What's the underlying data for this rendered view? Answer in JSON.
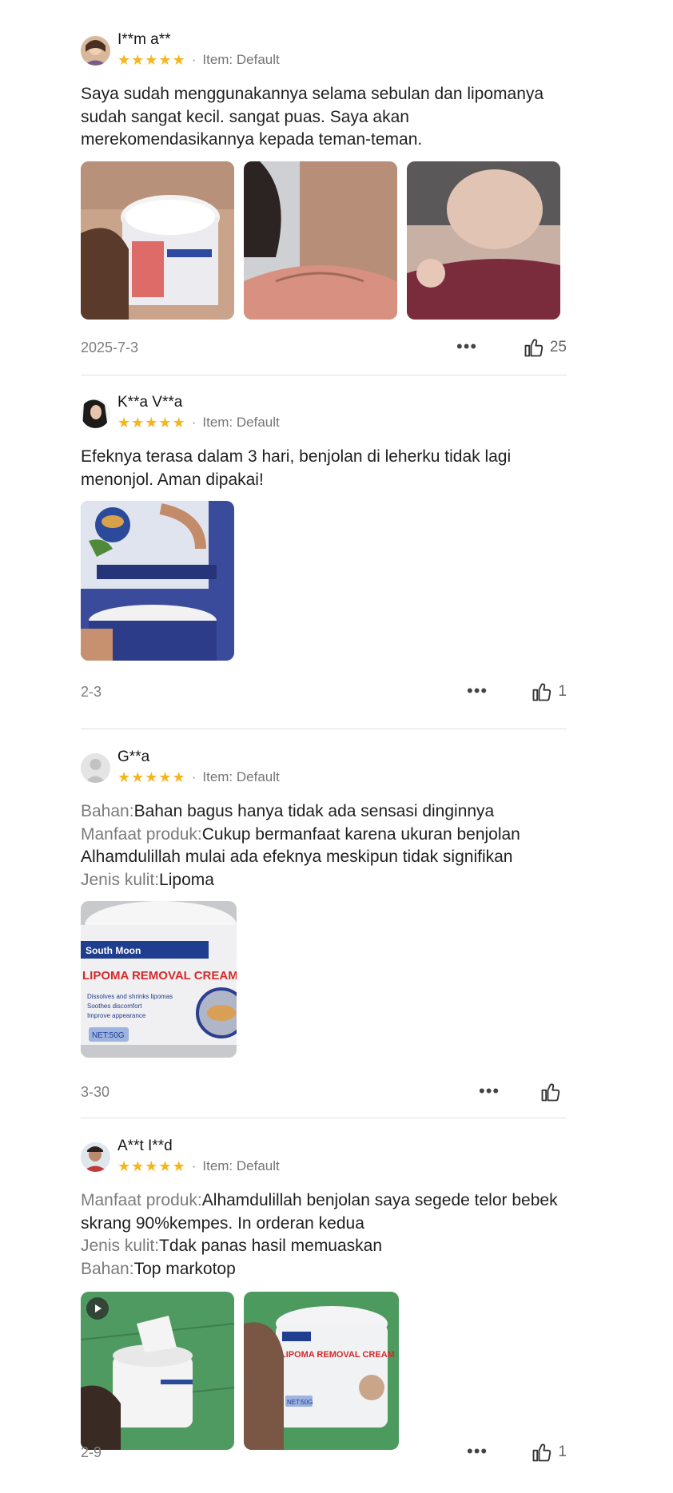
{
  "colors": {
    "star": "#f7b51c",
    "label": "#7b7b7b",
    "divider": "#e2e2e2"
  },
  "reviews": [
    {
      "username": "I**m a**",
      "stars": 5,
      "item": "Item: Default",
      "text": "Saya sudah menggunakannya selama sebulan dan lipomanya sudah sangat kecil. sangat puas. Saya akan merekomendasikannya kepada teman-teman.",
      "photo_count": 3,
      "date": "2025-7-3",
      "likes": "25"
    },
    {
      "username": "K**a V**a",
      "stars": 5,
      "item": "Item: Default",
      "text": "Efeknya terasa dalam 3 hari, benjolan di leherku tidak lagi menonjol. Aman dipakai!",
      "photo_count": 1,
      "date": "2-3",
      "likes": "1"
    },
    {
      "username": "G**a",
      "stars": 5,
      "item": "Item: Default",
      "fields": [
        {
          "label": "Bahan:",
          "value": "Bahan bagus hanya tidak ada sensasi dinginnya"
        },
        {
          "label": "Manfaat produk:",
          "value": "Cukup bermanfaat karena ukuran benjolan Alhamdulillah mulai ada efeknya meskipun tidak signifikan"
        },
        {
          "label": "Jenis kulit:",
          "value": "Lipoma"
        }
      ],
      "photo_count": 1,
      "photo_text": [
        "South Moon",
        "LIPOMA REMOVAL CREAM",
        "Dissolves and shrinks lipomas",
        "Soothes discomfort",
        "Improve appearance",
        "NET:50G"
      ],
      "date": "3-30",
      "likes": ""
    },
    {
      "username": "A**t I**d",
      "stars": 5,
      "item": "Item: Default",
      "fields": [
        {
          "label": "Manfaat produk:",
          "value": "Alhamdulillah benjolan saya segede telor bebek skrang 90%kempes. In orderan kedua"
        },
        {
          "label": "Jenis kulit:",
          "value": "Tdak panas hasil memuaskan"
        },
        {
          "label": "Bahan:",
          "value": "Top markotop"
        }
      ],
      "photo_count": 2,
      "photo_text": [
        "LIPOMA REMOVAL CREAM",
        "NET:50G"
      ],
      "date": "2-9",
      "likes": "1"
    }
  ],
  "icons": {
    "more": "more-dots-icon",
    "like": "thumbs-up-icon",
    "play": "play-icon",
    "star": "star-icon"
  }
}
